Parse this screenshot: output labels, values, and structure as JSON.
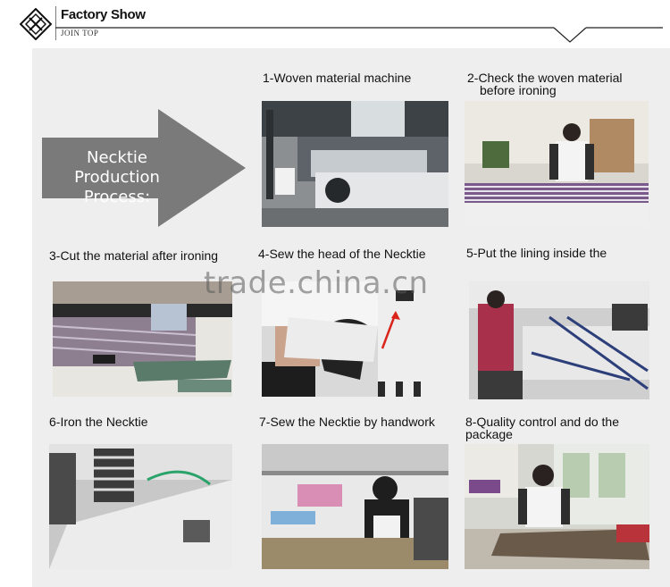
{
  "header": {
    "title": "Factory Show",
    "subtitle": "JOIN TOP",
    "logo_icon": "diamond-logo-icon"
  },
  "hero": {
    "line1": "Necktie Production",
    "line2": "Process:",
    "arrow_color": "#7a7a7a"
  },
  "steps": [
    {
      "caption": "1-Woven material machine"
    },
    {
      "caption_line1": "2-Check the woven material",
      "caption_line2": "before ironing"
    },
    {
      "caption": "3-Cut the material after ironing"
    },
    {
      "caption": "4-Sew the head of the Necktie"
    },
    {
      "caption": "5-Put the lining inside the"
    },
    {
      "caption": "6-Iron the Necktie"
    },
    {
      "caption": "7-Sew the Necktie by handwork"
    },
    {
      "caption_line1": "8-Quality control and do the",
      "caption_line2": "package"
    }
  ],
  "watermark": "trade.china.cn"
}
